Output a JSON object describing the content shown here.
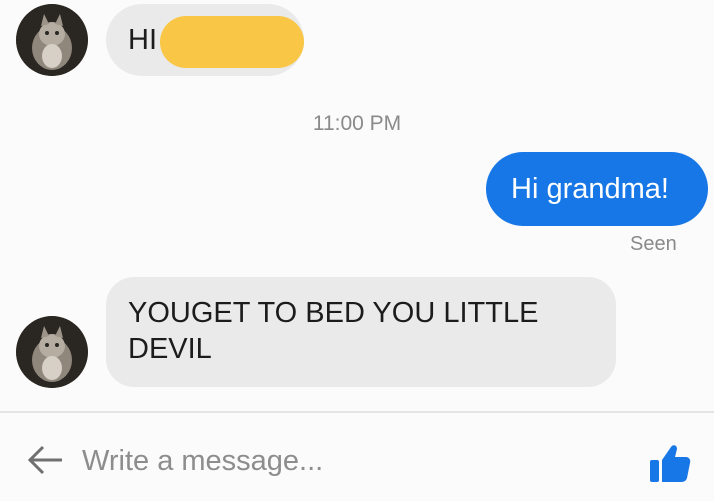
{
  "messages": [
    {
      "sender": "them",
      "text": "HI"
    },
    {
      "sender": "me",
      "text": "Hi grandma!"
    },
    {
      "sender": "them",
      "text": "YOUGET TO BED YOU LITTLE DEVIL"
    }
  ],
  "timestamp": "11:00 PM",
  "receipt": "Seen",
  "composer": {
    "placeholder": "Write a message...",
    "back_icon": "arrow-left-icon",
    "like_icon": "thumbs-up-icon"
  },
  "colors": {
    "outgoing_bubble": "#1877e6",
    "incoming_bubble": "#eaeaea",
    "redaction": "#f9c645"
  }
}
